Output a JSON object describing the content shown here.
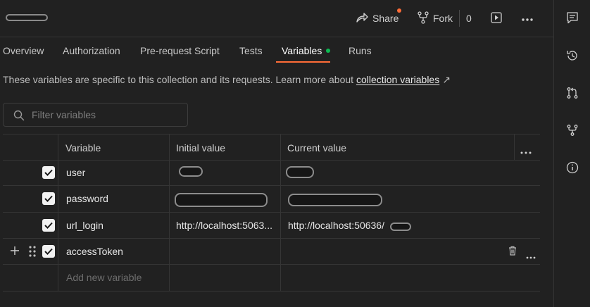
{
  "topbar": {
    "share_label": "Share",
    "fork_label": "Fork",
    "fork_count": "0"
  },
  "tabs": [
    {
      "label": "Overview"
    },
    {
      "label": "Authorization"
    },
    {
      "label": "Pre-request Script"
    },
    {
      "label": "Tests"
    },
    {
      "label": "Variables"
    },
    {
      "label": "Runs"
    }
  ],
  "active_tab": "Variables",
  "description": {
    "text": "These variables are specific to this collection and its requests. Learn more about ",
    "link_text": "collection variables",
    "link_arrow": "↗"
  },
  "filter": {
    "placeholder": "Filter variables"
  },
  "table": {
    "headers": {
      "variable": "Variable",
      "initial": "Initial value",
      "current": "Current value"
    },
    "rows": [
      {
        "name": "user",
        "initial": "",
        "current": "",
        "checked": true
      },
      {
        "name": "password",
        "initial": "",
        "current": "",
        "checked": true
      },
      {
        "name": "url_login",
        "initial": "http://localhost:5063...",
        "current": "http://localhost:50636/",
        "checked": true
      },
      {
        "name": "accessToken",
        "initial": "",
        "current": "",
        "checked": true
      }
    ],
    "add_placeholder": "Add new variable"
  },
  "colors": {
    "accent": "#ff6c37",
    "active_dot": "#0cbb52",
    "background": "#212121"
  },
  "icons": {
    "share": "share-arrow-icon",
    "fork": "fork-icon",
    "run": "run-play-icon",
    "more": "more-dots-icon",
    "comments": "comments-icon",
    "history": "history-icon",
    "pull_request": "pull-request-icon",
    "forks": "forks-icon",
    "info": "info-icon"
  }
}
